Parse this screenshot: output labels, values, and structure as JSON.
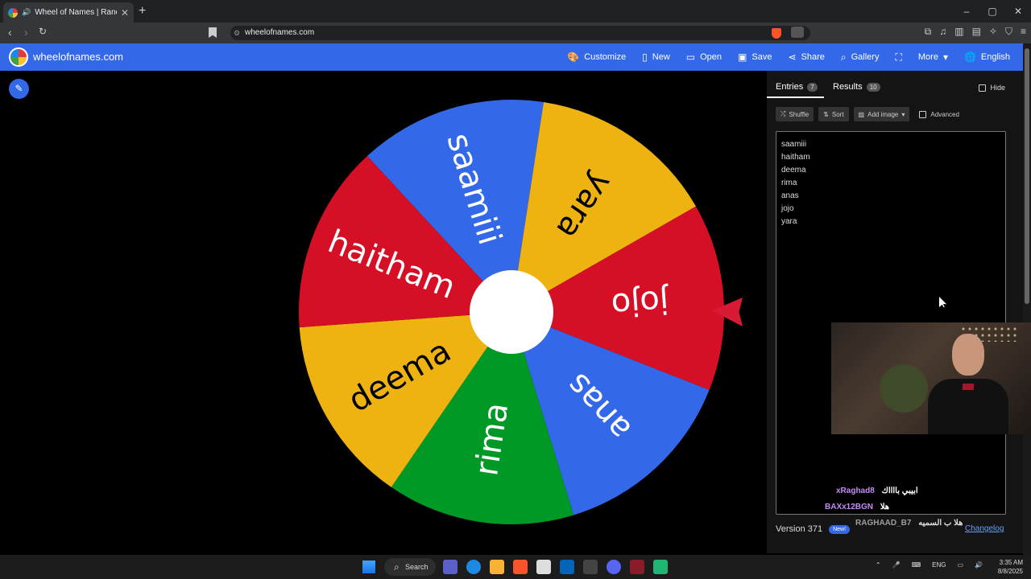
{
  "browser": {
    "tab_title": "Wheel of Names | Random n...",
    "url": "wheelofnames.com",
    "new_tab": "+",
    "close": "✕"
  },
  "app": {
    "brand": "wheelofnames.com",
    "menu": {
      "customize": "Customize",
      "new": "New",
      "open": "Open",
      "save": "Save",
      "share": "Share",
      "gallery": "Gallery",
      "more": "More",
      "language": "English"
    }
  },
  "wheel": {
    "segments": [
      {
        "label": "saamiii",
        "color": "#3369e8"
      },
      {
        "label": "yara",
        "color": "#eeb211"
      },
      {
        "label": "jojo",
        "color": "#d50f25"
      },
      {
        "label": "anas",
        "color": "#3369e8"
      },
      {
        "label": "rima",
        "color": "#009925"
      },
      {
        "label": "deema",
        "color": "#eeb211"
      },
      {
        "label": "haitham",
        "color": "#d50f25"
      }
    ],
    "rotation_deg": -17
  },
  "panel": {
    "entries_tab": "Entries",
    "entries_count": "7",
    "results_tab": "Results",
    "results_count": "10",
    "hide_label": "Hide",
    "shuffle": "Shuffle",
    "sort": "Sort",
    "add_image": "Add image",
    "advanced": "Advanced",
    "entries": [
      "saamiii",
      "haitham",
      "deema",
      "rima",
      "anas",
      "jojo",
      "yara"
    ],
    "version": "Version 371",
    "new_badge": "New!",
    "changelog": "Changelog"
  },
  "chat": [
    {
      "user": "xRaghad8",
      "message": "ابيبي بااااك",
      "color": "#c58af9"
    },
    {
      "user": "BAXx12BGN",
      "message": "هلا",
      "color": "#c58af9"
    },
    {
      "user": "RAGHAAD_B7",
      "message": "هلا ب السميه",
      "color": "#9e9e9e"
    }
  ],
  "taskbar": {
    "search": "Search",
    "lang": "ENG",
    "time": "3:35 AM",
    "date": "8/8/2025"
  }
}
